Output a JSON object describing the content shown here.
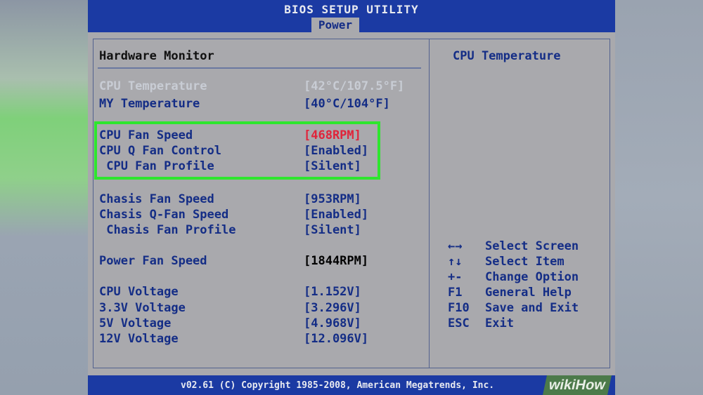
{
  "app": {
    "title": "BIOS SETUP UTILITY",
    "active_tab": "Power"
  },
  "main": {
    "section_title": "Hardware Monitor",
    "rows": [
      {
        "label": "CPU Temperature",
        "value": "[42°C/107.5°F]"
      },
      {
        "label": "MY Temperature",
        "value": "[40°C/104°F]"
      },
      {
        "label": "CPU Fan Speed",
        "value": "[468RPM]"
      },
      {
        "label": "CPU Q Fan Control",
        "value": "[Enabled]"
      },
      {
        "label": " CPU Fan Profile",
        "value": "[Silent]"
      },
      {
        "label": "Chasis Fan Speed",
        "value": "[953RPM]"
      },
      {
        "label": "Chasis Q-Fan Speed",
        "value": "[Enabled]"
      },
      {
        "label": " Chasis Fan Profile",
        "value": "[Silent]"
      },
      {
        "label": "Power Fan Speed",
        "value": "[1844RPM]"
      },
      {
        "label": "CPU Voltage",
        "value": "[1.152V]"
      },
      {
        "label": "3.3V Voltage",
        "value": "[3.296V]"
      },
      {
        "label": "5V Voltage",
        "value": "[4.968V]"
      },
      {
        "label": "12V Voltage",
        "value": "[12.096V]"
      }
    ]
  },
  "help": {
    "title": "CPU Temperature",
    "keys": [
      {
        "key": "←→",
        "desc": "Select Screen"
      },
      {
        "key": "↑↓",
        "desc": "Select Item"
      },
      {
        "key": "+-",
        "desc": "Change Option"
      },
      {
        "key": "F1",
        "desc": "General Help"
      },
      {
        "key": "F10",
        "desc": "Save and Exit"
      },
      {
        "key": "ESC",
        "desc": "Exit"
      }
    ]
  },
  "footer": {
    "copyright": "v02.61 (C) Copyright 1985-2008, American Megatrends, Inc.",
    "watermark": "wikiHow"
  },
  "colors": {
    "header_blue": "#1b3aa3",
    "panel_gray": "#a9a9ad",
    "text_blue": "#142d86",
    "highlight_green": "#2ee62e",
    "warning_red": "#e0243a"
  }
}
